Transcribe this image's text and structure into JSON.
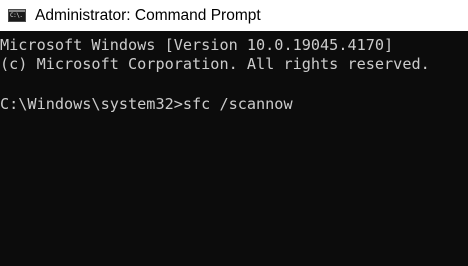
{
  "window": {
    "title": "Administrator: Command Prompt",
    "icon": "cmd-terminal-icon",
    "icon_text": "C:\\."
  },
  "console": {
    "background": "#0c0c0c",
    "foreground": "#cccccc",
    "lines": [
      "Microsoft Windows [Version 10.0.19045.4170]",
      "(c) Microsoft Corporation. All rights reserved.",
      "",
      "C:\\Windows\\system32>sfc /scannow"
    ]
  }
}
